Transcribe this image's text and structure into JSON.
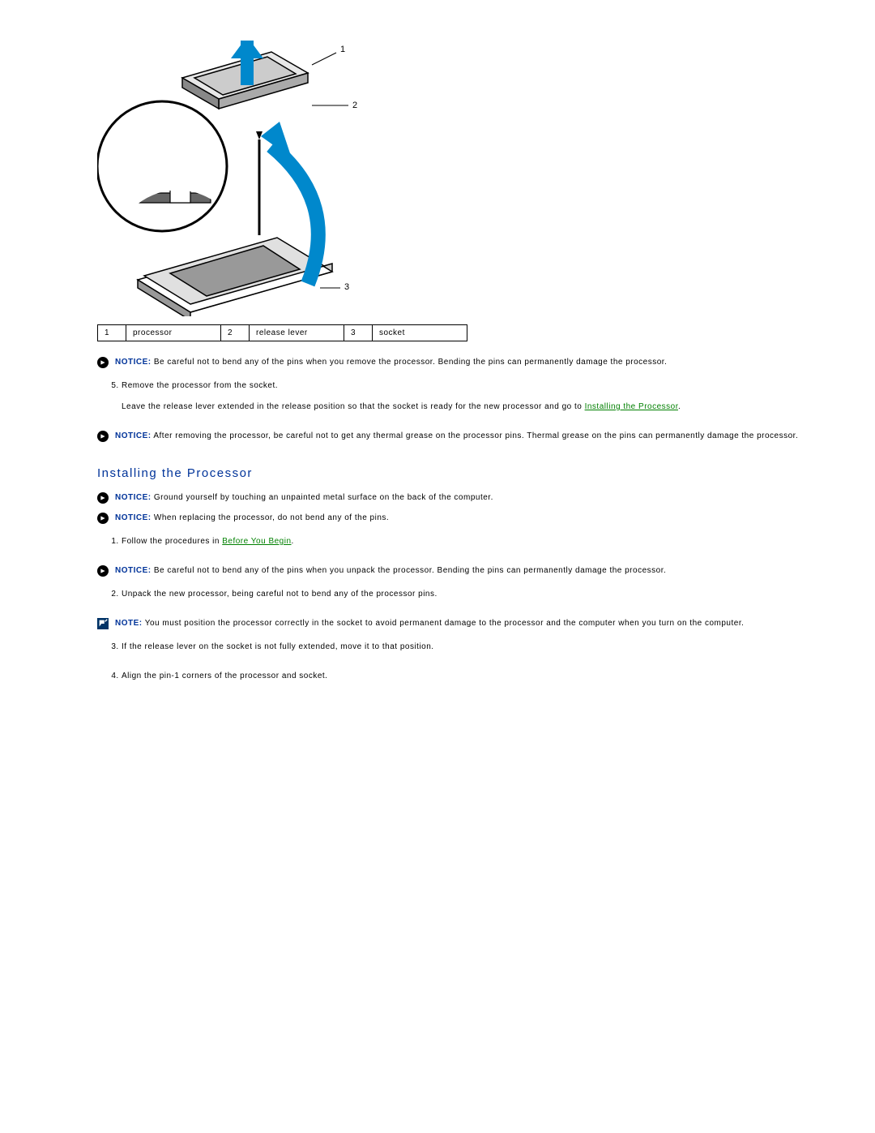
{
  "callouts": {
    "r1n": "1",
    "r1l": "processor",
    "r2n": "2",
    "r2l": "release lever",
    "r3n": "3",
    "r3l": "socket"
  },
  "diagramNums": {
    "n1": "1",
    "n2": "2",
    "n3": "3"
  },
  "notices": {
    "bendRemove": {
      "label": "NOTICE:",
      "text": " Be careful not to bend any of the pins when you remove the processor. Bending the pins can permanently damage the processor."
    },
    "thermal": {
      "label": "NOTICE:",
      "text": " After removing the processor, be careful not to get any thermal grease on the processor pins. Thermal grease on the pins can permanently damage the processor."
    },
    "ground": {
      "label": "NOTICE:",
      "text": " Ground yourself by touching an unpainted metal surface on the back of the computer."
    },
    "replace": {
      "label": "NOTICE:",
      "text": " When replacing the processor, do not bend any of the pins."
    },
    "bendUnpack": {
      "label": "NOTICE:",
      "text": " Be careful not to bend any of the pins when you unpack the processor. Bending the pins can permanently damage the processor."
    }
  },
  "notes": {
    "position": {
      "label": "NOTE:",
      "text": " You must position the processor correctly in the socket to avoid permanent damage to the processor and the computer when you turn on the computer."
    }
  },
  "steps": {
    "s5a": "Remove the processor from the socket.",
    "s5b_pre": "Leave the release lever extended in the release position so that the socket is ready for the new processor and go to ",
    "s5b_link": "Installing the Processor",
    "s5b_post": ".",
    "i1_pre": "Follow the procedures in ",
    "i1_link": "Before You Begin",
    "i1_post": ".",
    "i2": "Unpack the new processor, being careful not to bend any of the processor pins.",
    "i3": "If the release lever on the socket is not fully extended, move it to that position.",
    "i4": "Align the pin-1 corners of the processor and socket."
  },
  "heading": "Installing the Processor"
}
